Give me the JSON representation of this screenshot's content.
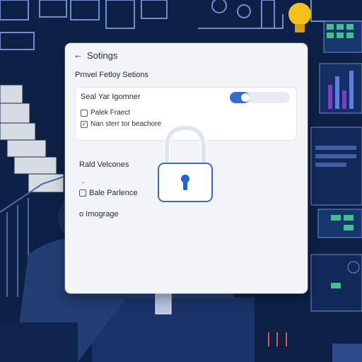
{
  "header": {
    "back_glyph": "←",
    "title": "Sotings"
  },
  "section1": {
    "title": "Prnvel Fetloy Setions",
    "row_label": "Seal Yar Igomner",
    "toggle_on": true,
    "options": [
      {
        "label": "Palek Fraect",
        "checked": false
      },
      {
        "label": "Nan sterr tor beachore",
        "checked": true
      }
    ]
  },
  "section2": {
    "title": "Rald Velcones",
    "dash": "-",
    "options": [
      {
        "label": "Bale Parlence",
        "checked": false
      },
      {
        "label": "o Imograge",
        "checked": false
      }
    ]
  },
  "icons": {
    "lock": "lock-icon",
    "bulb": "lightbulb-icon"
  },
  "colors": {
    "accent": "#2f6ed0",
    "background": "#0d2147",
    "bulb": "#f4c11c"
  }
}
